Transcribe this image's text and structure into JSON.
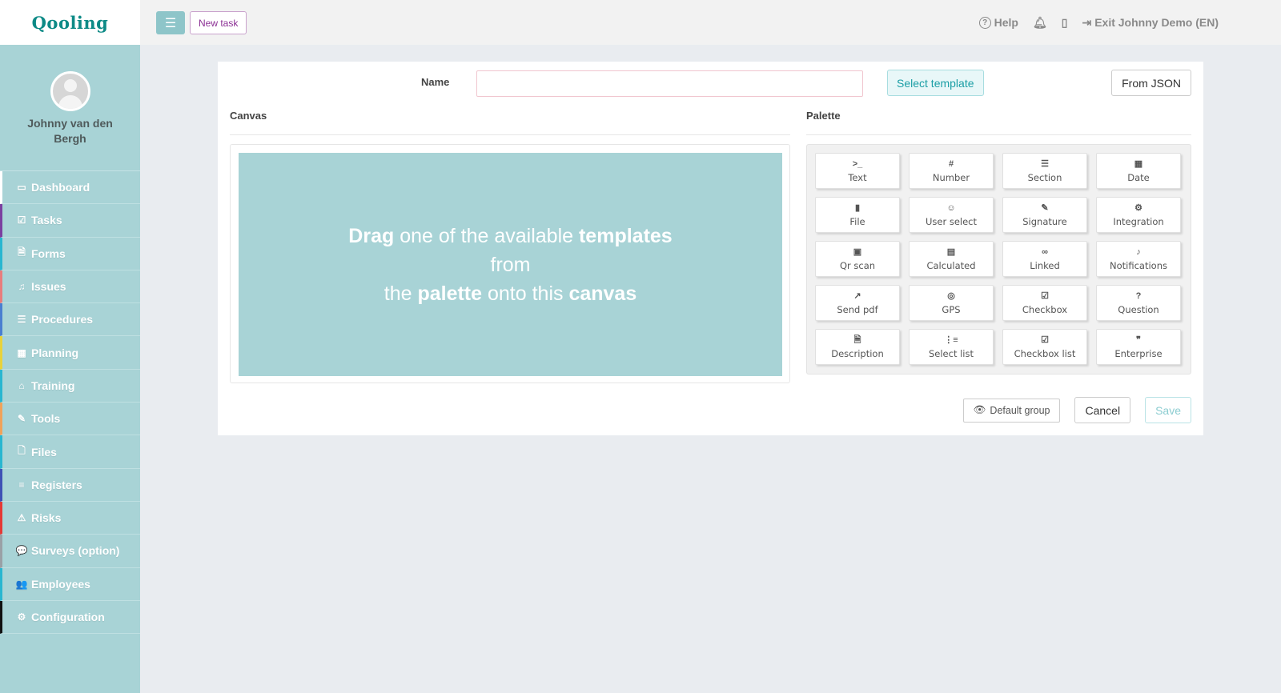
{
  "app": {
    "logo": "Qooling"
  },
  "user": {
    "name": "Johnny van den Bergh"
  },
  "sidebar": {
    "items": [
      {
        "label": "Dashboard",
        "icon": "monitor-icon",
        "glyph": "▭",
        "accent": "#ffffff"
      },
      {
        "label": "Tasks",
        "icon": "checkbox-icon",
        "glyph": "☑",
        "accent": "#7b3fa0"
      },
      {
        "label": "Forms",
        "icon": "document-icon",
        "glyph": "🗎",
        "accent": "#29b6d0"
      },
      {
        "label": "Issues",
        "icon": "bell-icon",
        "glyph": "♫",
        "accent": "#e87d7d"
      },
      {
        "label": "Procedures",
        "icon": "procedure-icon",
        "glyph": "☰",
        "accent": "#4a7fd0"
      },
      {
        "label": "Planning",
        "icon": "calendar-icon",
        "glyph": "▦",
        "accent": "#e8d23a"
      },
      {
        "label": "Training",
        "icon": "graduation-cap-icon",
        "glyph": "⌂",
        "accent": "#29b6d0"
      },
      {
        "label": "Tools",
        "icon": "wrench-icon",
        "glyph": "✎",
        "accent": "#f0a25a"
      },
      {
        "label": "Files",
        "icon": "file-icon",
        "glyph": "🗋",
        "accent": "#29b6d0"
      },
      {
        "label": "Registers",
        "icon": "list-icon",
        "glyph": "≡",
        "accent": "#3f51b5"
      },
      {
        "label": "Risks",
        "icon": "warning-icon",
        "glyph": "⚠",
        "accent": "#e53935"
      },
      {
        "label": "Surveys (option)",
        "icon": "comments-icon",
        "glyph": "💬",
        "accent": "#9aa0a6"
      },
      {
        "label": "Employees",
        "icon": "users-icon",
        "glyph": "👥",
        "accent": "#29b6d0"
      },
      {
        "label": "Configuration",
        "icon": "gear-icon",
        "glyph": "⚙",
        "accent": "#111111"
      }
    ]
  },
  "topbar": {
    "new_task": "New task",
    "help": "Help",
    "exit": "Exit Johnny Demo (EN)"
  },
  "form": {
    "name_label": "Name",
    "name_value": "",
    "select_template": "Select template",
    "from_json": "From JSON",
    "canvas_title": "Canvas",
    "palette_title": "Palette",
    "canvas_hint": {
      "l1a": "Drag",
      "l1b": " one of the available ",
      "l1c": "templates",
      "l2": "from",
      "l3a": "the ",
      "l3b": "palette",
      "l3c": " onto this ",
      "l3d": "canvas"
    }
  },
  "palette": [
    {
      "label": "Text",
      "icon": "terminal-icon",
      "glyph": ">_"
    },
    {
      "label": "Number",
      "icon": "hash-icon",
      "glyph": "#"
    },
    {
      "label": "Section",
      "icon": "section-icon",
      "glyph": "☰"
    },
    {
      "label": "Date",
      "icon": "calendar-icon",
      "glyph": "▦"
    },
    {
      "label": "File",
      "icon": "file-icon",
      "glyph": "▮"
    },
    {
      "label": "User select",
      "icon": "user-circle-icon",
      "glyph": "☺"
    },
    {
      "label": "Signature",
      "icon": "signature-icon",
      "glyph": "✎"
    },
    {
      "label": "Integration",
      "icon": "cogs-icon",
      "glyph": "⚙"
    },
    {
      "label": "Qr scan",
      "icon": "qrcode-icon",
      "glyph": "▣"
    },
    {
      "label": "Calculated",
      "icon": "calculator-icon",
      "glyph": "▤"
    },
    {
      "label": "Linked",
      "icon": "link-icon",
      "glyph": "∞"
    },
    {
      "label": "Notifications",
      "icon": "bell-icon",
      "glyph": "♪"
    },
    {
      "label": "Send pdf",
      "icon": "share-icon",
      "glyph": "↗"
    },
    {
      "label": "GPS",
      "icon": "compass-icon",
      "glyph": "◎"
    },
    {
      "label": "Checkbox",
      "icon": "check-square-icon",
      "glyph": "☑"
    },
    {
      "label": "Question",
      "icon": "question-circle-icon",
      "glyph": "?"
    },
    {
      "label": "Description",
      "icon": "document-icon",
      "glyph": "🗎"
    },
    {
      "label": "Select list",
      "icon": "list-ol-icon",
      "glyph": "⋮≡"
    },
    {
      "label": "Checkbox list",
      "icon": "check-square-icon",
      "glyph": "☑"
    },
    {
      "label": "Enterprise",
      "icon": "quote-icon",
      "glyph": "❞"
    }
  ],
  "footer": {
    "default_group": "Default group",
    "cancel": "Cancel",
    "save": "Save"
  },
  "colors": {
    "sidebar": "#a8d3d6",
    "brand": "#0d8a86",
    "canvas": "#a8d3d6"
  }
}
